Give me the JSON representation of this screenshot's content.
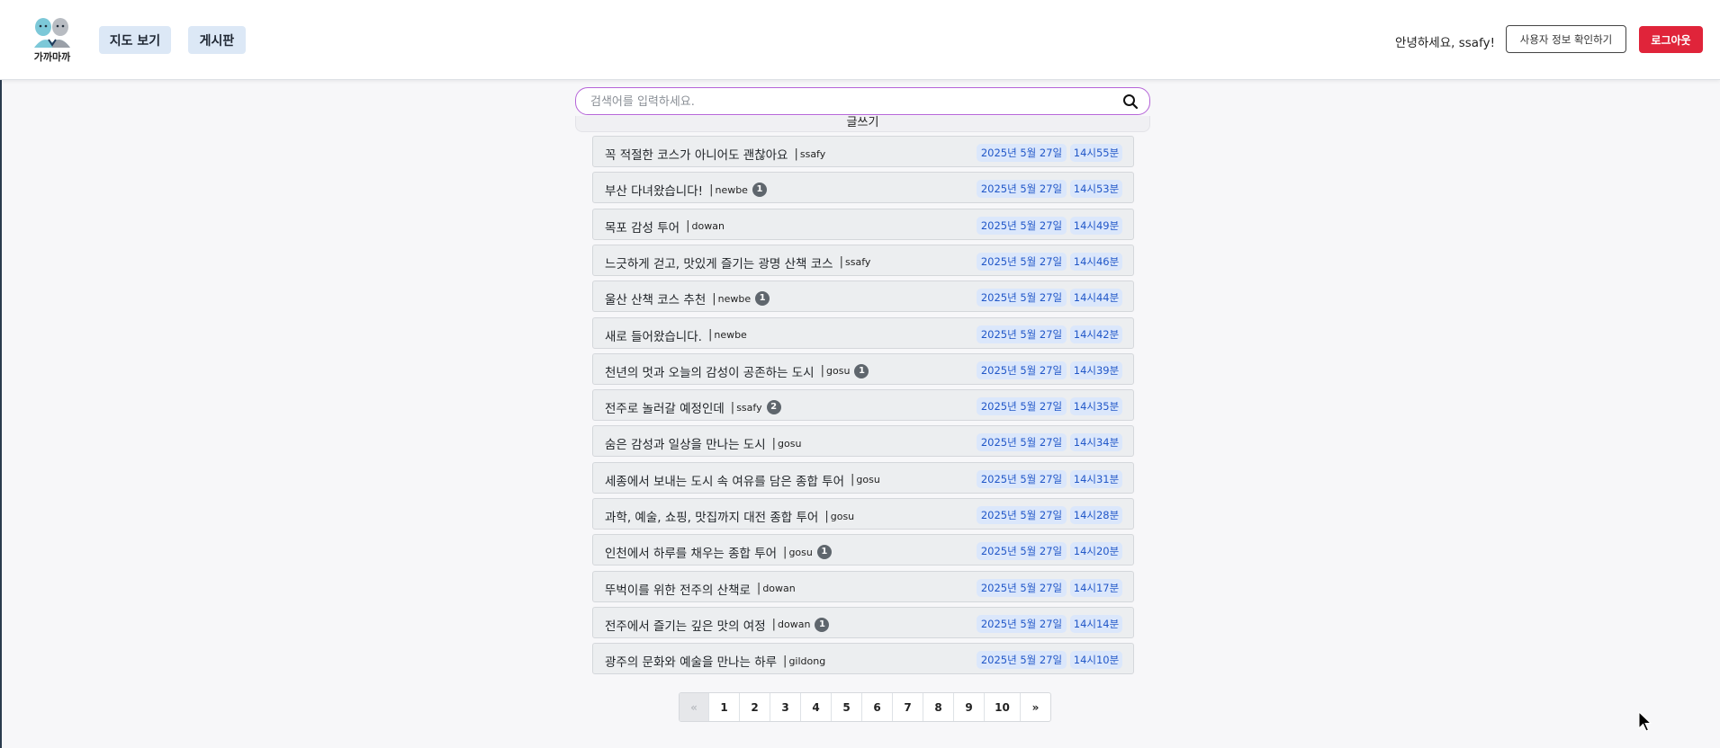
{
  "header": {
    "logo_text": "가까마까",
    "nav": [
      {
        "label": "지도 보기"
      },
      {
        "label": "게시판"
      }
    ],
    "greeting": "안녕하세요, ssafy!",
    "user_info_label": "사용자 정보 확인하기",
    "logout_label": "로그아웃"
  },
  "search": {
    "placeholder": "검색어를 입력하세요.",
    "value": ""
  },
  "write_label": "글쓰기",
  "posts": [
    {
      "title": "꼭 적절한 코스가 아니어도 괜찮아요",
      "author": "ssafy",
      "comments": "",
      "date": "2025년 5월 27일",
      "time": "14시55분"
    },
    {
      "title": "부산 다녀왔습니다!",
      "author": "newbe",
      "comments": "1",
      "date": "2025년 5월 27일",
      "time": "14시53분"
    },
    {
      "title": "목포 감성 투어",
      "author": "dowan",
      "comments": "",
      "date": "2025년 5월 27일",
      "time": "14시49분"
    },
    {
      "title": "느긋하게 걷고, 맛있게 즐기는 광명 산책 코스",
      "author": "ssafy",
      "comments": "",
      "date": "2025년 5월 27일",
      "time": "14시46분"
    },
    {
      "title": "울산 산책 코스 추천",
      "author": "newbe",
      "comments": "1",
      "date": "2025년 5월 27일",
      "time": "14시44분"
    },
    {
      "title": "새로 들어왔습니다.",
      "author": "newbe",
      "comments": "",
      "date": "2025년 5월 27일",
      "time": "14시42분"
    },
    {
      "title": "천년의 멋과 오늘의 감성이 공존하는 도시",
      "author": "gosu",
      "comments": "1",
      "date": "2025년 5월 27일",
      "time": "14시39분"
    },
    {
      "title": "전주로 놀러갈 예정인데",
      "author": "ssafy",
      "comments": "2",
      "date": "2025년 5월 27일",
      "time": "14시35분"
    },
    {
      "title": "숨은 감성과 일상을 만나는 도시",
      "author": "gosu",
      "comments": "",
      "date": "2025년 5월 27일",
      "time": "14시34분"
    },
    {
      "title": "세종에서 보내는 도시 속 여유를 담은 종합 투어",
      "author": "gosu",
      "comments": "",
      "date": "2025년 5월 27일",
      "time": "14시31분"
    },
    {
      "title": "과학, 예술, 쇼핑, 맛집까지 대전 종합 투어",
      "author": "gosu",
      "comments": "",
      "date": "2025년 5월 27일",
      "time": "14시28분"
    },
    {
      "title": "인천에서 하루를 채우는 종합 투어",
      "author": "gosu",
      "comments": "1",
      "date": "2025년 5월 27일",
      "time": "14시20분"
    },
    {
      "title": "뚜벅이를 위한 전주의 산책로",
      "author": "dowan",
      "comments": "",
      "date": "2025년 5월 27일",
      "time": "14시17분"
    },
    {
      "title": "전주에서 즐기는 깊은 맛의 여정",
      "author": "dowan",
      "comments": "1",
      "date": "2025년 5월 27일",
      "time": "14시14분"
    },
    {
      "title": "광주의 문화와 예술을 만나는 하루",
      "author": "gildong",
      "comments": "",
      "date": "2025년 5월 27일",
      "time": "14시10분"
    }
  ],
  "post_separator": "|",
  "pagination": {
    "prev": "«",
    "pages": [
      "1",
      "2",
      "3",
      "4",
      "5",
      "6",
      "7",
      "8",
      "9",
      "10"
    ],
    "next": "»"
  },
  "colors": {
    "logout": "#e0243a",
    "nav_bg": "#dce8f6",
    "date_badge_bg": "#dbe7fb",
    "date_badge_text": "#2157c8",
    "search_border": "#b564d8"
  }
}
